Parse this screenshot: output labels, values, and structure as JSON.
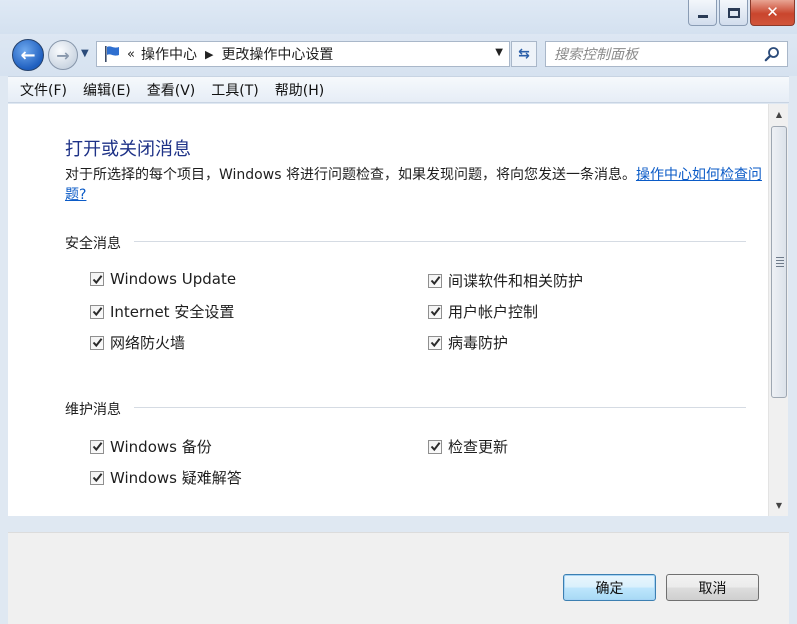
{
  "window": {
    "controls": {
      "minimize": "minimize",
      "maximize": "maximize",
      "close": "✕"
    }
  },
  "address": {
    "prefix": "«",
    "crumbs": [
      "操作中心",
      "更改操作中心设置"
    ],
    "search_placeholder": "搜索控制面板"
  },
  "menu": [
    "文件(F)",
    "编辑(E)",
    "查看(V)",
    "工具(T)",
    "帮助(H)"
  ],
  "main": {
    "heading": "打开或关闭消息",
    "description": "对于所选择的每个项目，Windows 将进行问题检查，如果发现问题，将向您发送一条消息。",
    "description_link": "操作中心如何检查问题?",
    "sections": [
      {
        "title": "安全消息",
        "items": [
          {
            "label": "Windows Update",
            "checked": true
          },
          {
            "label": "间谍软件和相关防护",
            "checked": true
          },
          {
            "label": "Internet 安全设置",
            "checked": true
          },
          {
            "label": "用户帐户控制",
            "checked": true
          },
          {
            "label": "网络防火墙",
            "checked": true
          },
          {
            "label": "病毒防护",
            "checked": true
          }
        ]
      },
      {
        "title": "维护消息",
        "items": [
          {
            "label": "Windows 备份",
            "checked": true
          },
          {
            "label": "检查更新",
            "checked": true
          },
          {
            "label": "Windows 疑难解答",
            "checked": true
          }
        ]
      }
    ]
  },
  "buttons": {
    "ok": "确定",
    "cancel": "取消"
  },
  "colors": {
    "heading": "#1e3287",
    "link": "#0b5bc7",
    "accent": "#1f5fbf"
  }
}
